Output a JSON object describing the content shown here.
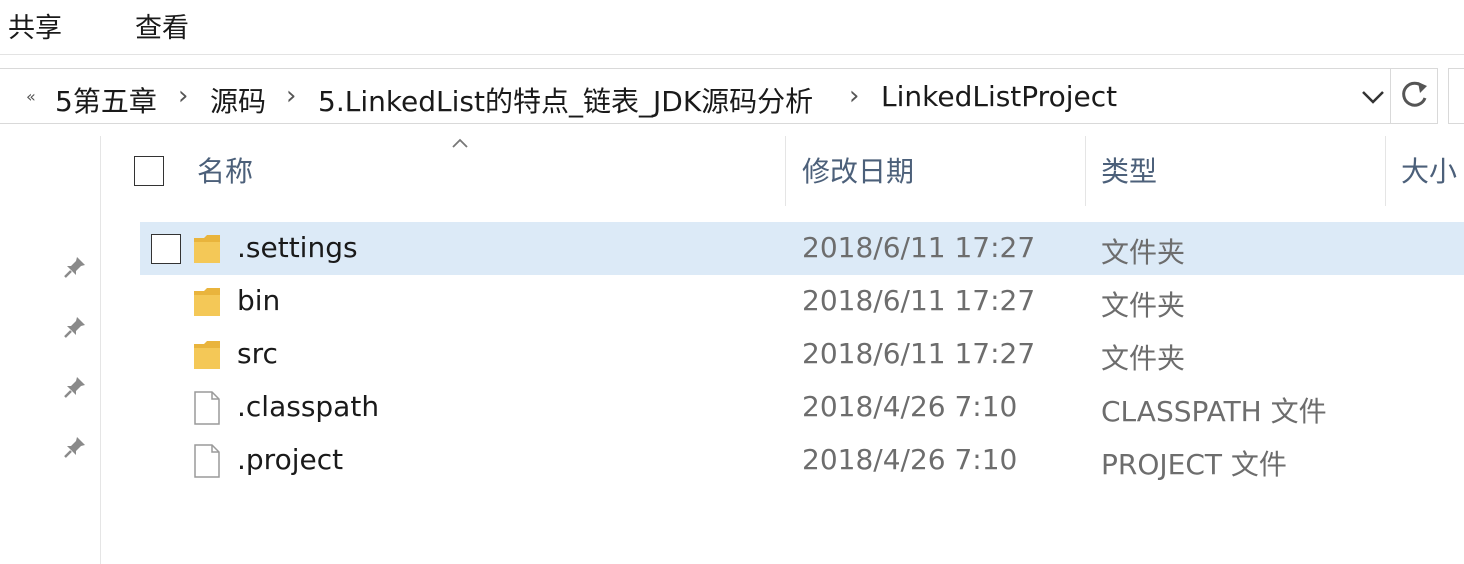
{
  "ribbon": {
    "tabs": [
      "共享",
      "查看"
    ]
  },
  "address_bar": {
    "overflow_chevron": "«",
    "crumbs": [
      "5第五章",
      "源码",
      "5.LinkedList的特点_链表_JDK源码分析",
      "LinkedListProject"
    ],
    "separator_icon": "chevron-right-icon"
  },
  "columns": {
    "name": "名称",
    "date": "修改日期",
    "type": "类型",
    "size": "大小"
  },
  "files": [
    {
      "name": ".settings",
      "date": "2018/6/11 17:27",
      "type": "文件夹",
      "kind": "folder",
      "selected": true
    },
    {
      "name": "bin",
      "date": "2018/6/11 17:27",
      "type": "文件夹",
      "kind": "folder",
      "selected": false
    },
    {
      "name": "src",
      "date": "2018/6/11 17:27",
      "type": "文件夹",
      "kind": "folder",
      "selected": false
    },
    {
      "name": ".classpath",
      "date": "2018/4/26 7:10",
      "type": "CLASSPATH 文件",
      "kind": "file",
      "selected": false
    },
    {
      "name": ".project",
      "date": "2018/4/26 7:10",
      "type": "PROJECT 文件",
      "kind": "file",
      "selected": false
    }
  ],
  "colors": {
    "selected_row": "#dceaf7",
    "header_text": "#4c607a",
    "folder": "#f4c857"
  },
  "nav_pane": {
    "pins": [
      "pin-icon",
      "pin-icon",
      "pin-icon",
      "pin-icon"
    ]
  }
}
